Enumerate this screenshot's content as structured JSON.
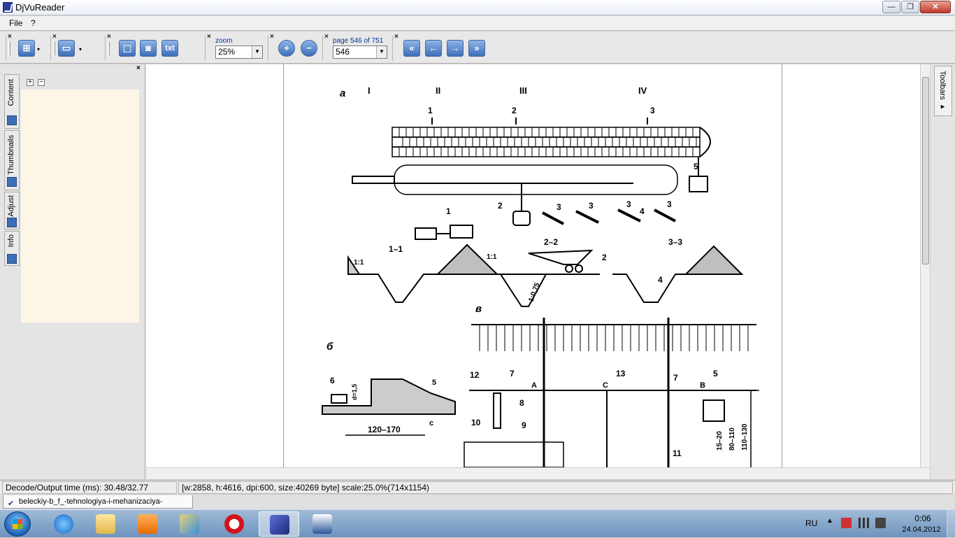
{
  "window": {
    "title": "DjVuReader",
    "min": "—",
    "max": "❐",
    "close": "✕"
  },
  "menu": {
    "file": "File",
    "help": "?"
  },
  "toolbar": {
    "close_glyph": "×",
    "dropdown_glyph": "▾",
    "txt_label": "txt",
    "zoom_label": "zoom",
    "zoom_value": "25%",
    "page_label": "page 546 of 751",
    "page_value": "546"
  },
  "sidebar": {
    "close": "×",
    "tabs": [
      "Content",
      "Thumbnails",
      "Adjust",
      "Info"
    ],
    "expand": "+",
    "collapse": "−"
  },
  "page_labels": {
    "a": "а",
    "b": "б",
    "v": "в",
    "I": "I",
    "II": "II",
    "III": "III",
    "IV": "IV",
    "n1": "1",
    "n2": "2",
    "n3": "3",
    "n4": "4",
    "n5": "5",
    "n6": "6",
    "n7": "7",
    "n8": "8",
    "n9": "9",
    "n10": "10",
    "n11": "11",
    "n12": "12",
    "n13": "13",
    "s11": "1–1",
    "s22": "2–2",
    "s33": "3–3",
    "slope1": "1:1",
    "slope075": "1:0,75",
    "A": "A",
    "B": "B",
    "C": "C",
    "c": "c",
    "dim_d": "d=1,5",
    "dim_120": "120–170",
    "dim_15": "15–20",
    "dim_80": "80–110",
    "dim_110": "110–130"
  },
  "rightbar": {
    "toolbars": "Toolbars ▸"
  },
  "status": {
    "decode": "Decode/Output time (ms): 30.48/32.77",
    "info": "[w:2858, h:4616, dpi:600, size:40269 byte] scale:25.0%(714x1154)"
  },
  "doc_tab": {
    "filename": "beleckiy-b_f_-tehnologiya-i-mehanizaciya-stroit.djvu"
  },
  "taskbar": {
    "apps": [
      "internet-explorer",
      "file-explorer",
      "media-player",
      "paint",
      "opera",
      "djvureader",
      "word"
    ],
    "lang": "RU",
    "time": "0:06",
    "date": "24.04.2012"
  }
}
